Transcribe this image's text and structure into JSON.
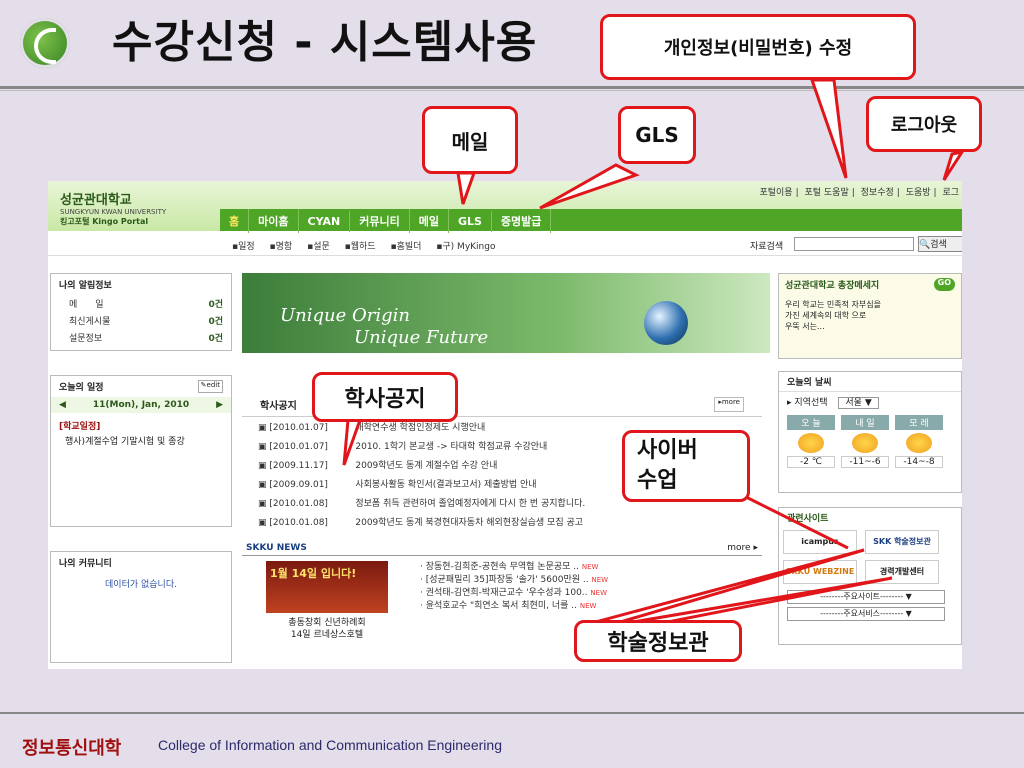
{
  "slide": {
    "title": "수강신청 - 시스템사용",
    "footer_main": "정보통신대학",
    "footer_sub": "College of Information and Communication Engineering"
  },
  "callouts": {
    "password": "개인정보(비밀번호) 수정",
    "logout": "로그아웃",
    "mail": "메일",
    "gls": "GLS",
    "notice": "학사공지",
    "cyber": "사이버\n수업",
    "library": "학술정보관"
  },
  "portal": {
    "logo_ko": "성균관대학교",
    "logo_en": "SUNGKYUN KWAN UNIVERSITY",
    "logo_portal": "킹고포털 Kingo Portal",
    "util": [
      "포털이용",
      "포털 도움말",
      "정보수정",
      "도움방",
      "로그"
    ],
    "nav": [
      "홈",
      "마이홈",
      "CYAN",
      "커뮤니티",
      "메일",
      "GLS",
      "증명발급"
    ],
    "quick": [
      "일정",
      "명함",
      "설문",
      "웹하드",
      "홈빌더",
      "구) MyKingo"
    ],
    "search_label": "자료검색",
    "search_button": "검색",
    "alerts": {
      "title": "나의 알림정보",
      "rows": [
        {
          "label": "메　　일",
          "count": "0건"
        },
        {
          "label": "최신게시물",
          "count": "0건"
        },
        {
          "label": "설문정보",
          "count": "0건"
        }
      ]
    },
    "schedule": {
      "title": "오늘의 일정",
      "edit": "edit",
      "date": "11(Mon), Jan, 2010",
      "section": "[학교일정]",
      "entry": "행사)계절수업 기말시험 및 종강"
    },
    "community": {
      "title": "나의 커뮤니티",
      "empty": "데이터가 없습니다."
    },
    "banner": {
      "line1": "Unique Origin",
      "line2": "Unique Future"
    },
    "notice": {
      "title": "학사공지",
      "more": "more",
      "items": [
        {
          "date": "[2010.01.07]",
          "text": "대학연수생 학점인정제도 시행안내"
        },
        {
          "date": "[2010.01.07]",
          "text": "2010. 1학기 본교생 -> 타대학 학점교류 수강안내"
        },
        {
          "date": "[2009.11.17]",
          "text": "2009학년도 동계 계절수업 수강 안내"
        },
        {
          "date": "[2009.09.01]",
          "text": "사회봉사활동 확인서(결과보고서) 제출방법 안내"
        },
        {
          "date": "[2010.01.08]",
          "text": "정보폼 취득 관련하여 졸업예정자에게 다시 한 번 공지합니다."
        },
        {
          "date": "[2010.01.08]",
          "text": "2009학년도 동계 북경현대자동차 해외현장실습생 모집 공고"
        }
      ]
    },
    "news": {
      "title": "SKKU NEWS",
      "more": "more",
      "pic_title": "1월 14일 입니다!",
      "caption": "총동창회 신년하례회\n14일 르네상스호텔",
      "items": [
        "장동현-김희준-공현속 무역협 논문공모 ..",
        "[성균패밀리 35]파장동 '솔가' 5600만원 ..",
        "권석태-김연희-박재근교수 '우수성과 100..",
        "윤석호교수 \"희연소 복서 최현미, 너를 .."
      ],
      "new_badge": "NEW"
    },
    "president": {
      "title": "성균관대학교 총장메세지",
      "go": "GO",
      "text": "우리 학교는 민족적 자부심을\n가진 세계속의 대학 으로\n우뚝 서는..."
    },
    "weather": {
      "title": "오늘의 날씨",
      "region_label": "지역선택",
      "region": "서울",
      "days": [
        {
          "label": "오 늘",
          "temp": "-2 ℃"
        },
        {
          "label": "내 일",
          "temp": "-11~-6"
        },
        {
          "label": "모 레",
          "temp": "-14~-8"
        }
      ]
    },
    "related": {
      "title": "관련사이트",
      "sites": [
        "icampus",
        "SKK 학술정보관",
        "SKKU WEBZINE",
        "경력개발센터"
      ],
      "select1": "--------주요사이트--------",
      "select2": "--------주요서비스--------"
    }
  }
}
